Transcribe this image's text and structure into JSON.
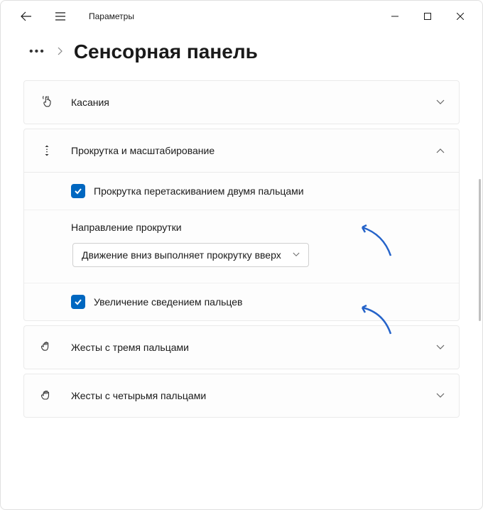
{
  "header": {
    "app_title": "Параметры"
  },
  "breadcrumb": {
    "page_title": "Сенсорная панель"
  },
  "sections": {
    "taps": {
      "title": "Касания"
    },
    "scroll": {
      "title": "Прокрутка и масштабирование",
      "drag_two_fingers": "Прокрутка перетаскиванием двумя пальцами",
      "direction_label": "Направление прокрутки",
      "direction_value": "Движение вниз выполняет прокрутку вверх",
      "pinch_zoom": "Увеличение сведением пальцев"
    },
    "three_fingers": {
      "title": "Жесты с тремя пальцами"
    },
    "four_fingers": {
      "title": "Жесты с четырьмя пальцами"
    }
  }
}
